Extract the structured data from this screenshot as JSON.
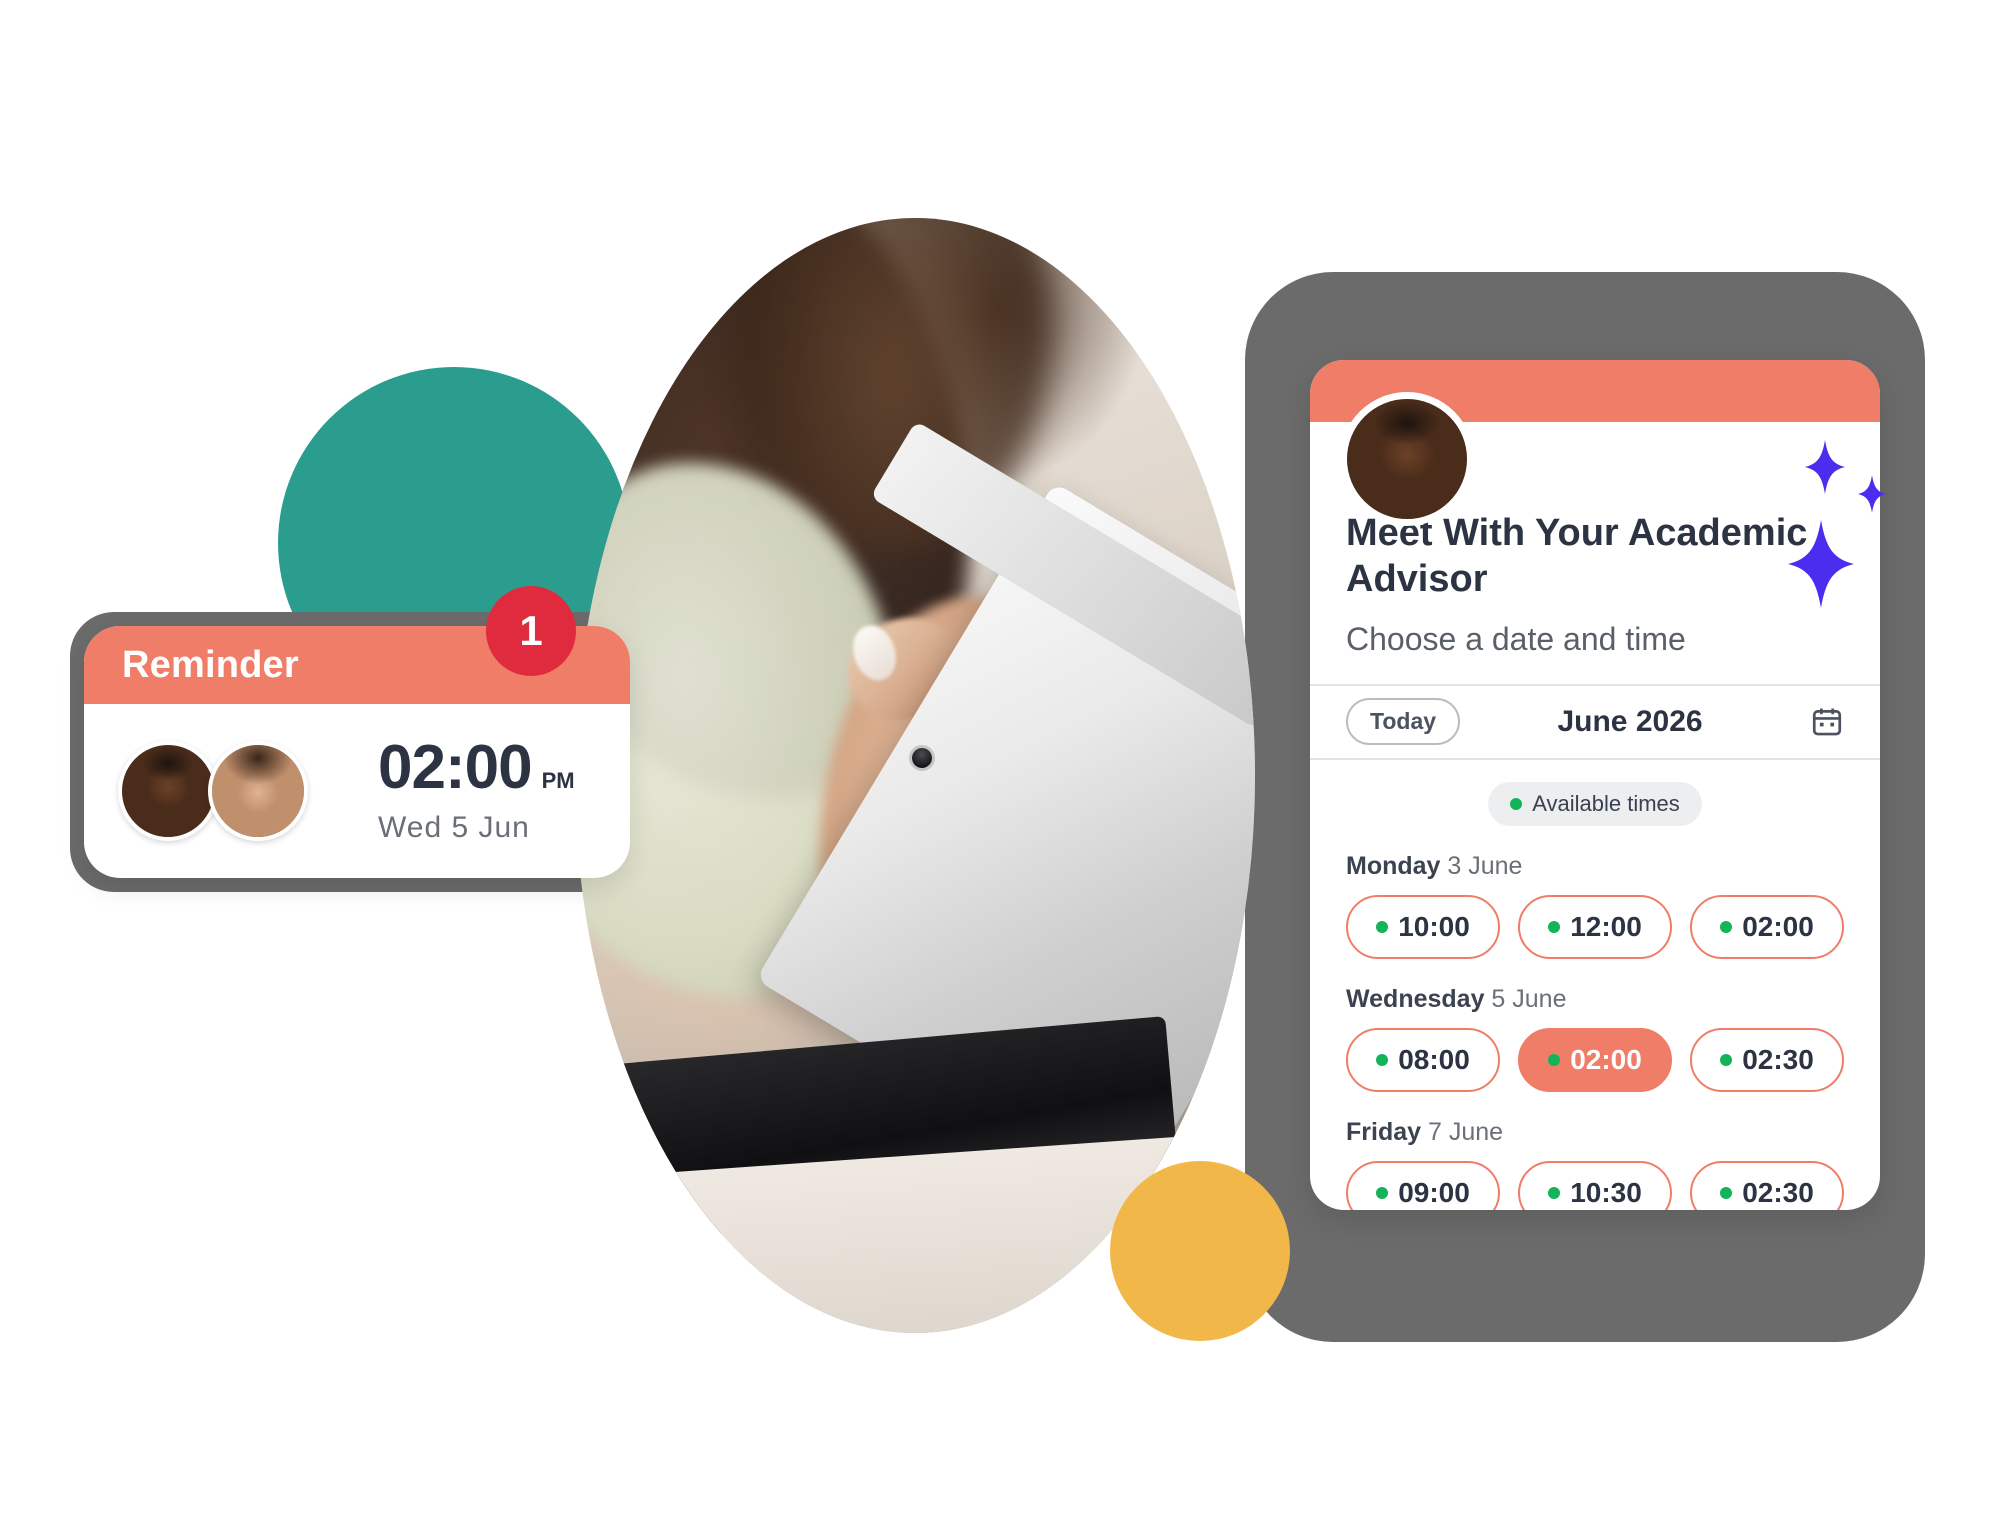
{
  "colors": {
    "coral": "#ef7d68",
    "teal": "#2a9d8f",
    "yellow": "#f2b749",
    "grey_shell": "#6b6b6b",
    "badge_red": "#e02b3f",
    "available_green": "#13b35a",
    "text_dark": "#2c3443",
    "purple_sparkle": "#4b2df0"
  },
  "reminder_card": {
    "header_title": "Reminder",
    "badge_count": "1",
    "time": "02:00",
    "meridiem": "PM",
    "date": "Wed 5 Jun",
    "avatars": [
      "advisor-avatar",
      "student-avatar"
    ]
  },
  "scheduler_card": {
    "avatar": "advisor-avatar",
    "title": "Meet With Your Academic Advisor",
    "subtitle": "Choose a date and time",
    "today_label": "Today",
    "month_label": "June 2026",
    "calendar_icon": "calendar-icon",
    "available_label": "Available times",
    "days": [
      {
        "weekday": "Monday",
        "date": " 3 June",
        "slots": [
          {
            "time": "10:00",
            "selected": false
          },
          {
            "time": "12:00",
            "selected": false
          },
          {
            "time": "02:00",
            "selected": false
          }
        ]
      },
      {
        "weekday": "Wednesday",
        "date": " 5 June",
        "slots": [
          {
            "time": "08:00",
            "selected": false
          },
          {
            "time": "02:00",
            "selected": true
          },
          {
            "time": "02:30",
            "selected": false
          }
        ]
      },
      {
        "weekday": "Friday",
        "date": " 7 June",
        "slots": [
          {
            "time": "09:00",
            "selected": false
          },
          {
            "time": "10:30",
            "selected": false
          },
          {
            "time": "02:30",
            "selected": false
          }
        ]
      }
    ]
  },
  "decor": {
    "sparkles": [
      "sparkle-small-icon",
      "sparkle-tiny-icon",
      "sparkle-large-icon"
    ],
    "photo": "woman-using-tablet-photo"
  }
}
